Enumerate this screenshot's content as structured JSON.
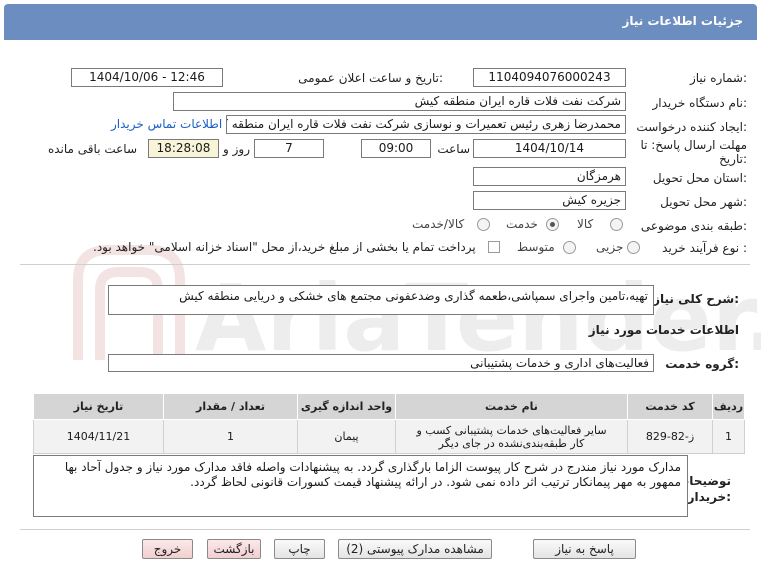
{
  "header": {
    "title": "جزئیات اطلاعات نیاز"
  },
  "fields": {
    "need_number_label": "شماره نیاز:",
    "need_number": "1104094076000243",
    "announce_label": "تاریخ و ساعت اعلان عمومی:",
    "announce_value": "1404/10/06 - 12:46",
    "buyer_org_label": "نام دستگاه خریدار:",
    "buyer_org": "شرکت نفت فلات قاره ایران منطقه کیش",
    "creator_label": "ایجاد کننده درخواست:",
    "creator": "محمدرضا  زهری رئیس تعمیرات و نوسازی  شرکت نفت فلات قاره ایران منطقه کیش",
    "contact_link": "اطلاعات تماس خریدار",
    "deadline_label_1": "مهلت ارسال پاسخ: تا",
    "deadline_label_2": "تاریخ:",
    "deadline_date": "1404/10/14",
    "time_label": "ساعت",
    "deadline_time": "09:00",
    "days_value": "7",
    "days_label": "روز و",
    "remaining_time": "18:28:08",
    "remaining_label": "ساعت باقی مانده",
    "province_label": "استان محل تحویل:",
    "province": "هرمزگان",
    "city_label": "شهر محل تحویل:",
    "city": "جزیره کیش",
    "category_label": "طبقه بندی موضوعی:",
    "category_options": [
      "کالا",
      "خدمت",
      "کالا/خدمت"
    ],
    "category_selected": "خدمت",
    "process_label": "نوع فرآیند خرید :",
    "process_options": [
      "جزیی",
      "متوسط"
    ],
    "process_note": "پرداخت تمام یا بخشی از مبلغ خرید،از محل \"اسناد خزانه اسلامی\" خواهد بود."
  },
  "description": {
    "label": "شرح کلی نیاز:",
    "text": "تهیه،تامین واجرای سمپاشی،طعمه گذاری وضدعفونی مجتمع های خشکی و دریایی منطقه کیش"
  },
  "services_section": {
    "title": "اطلاعات خدمات مورد نیاز",
    "group_label": "گروه خدمت:",
    "group_value": "فعالیت‌های اداری و خدمات پشتیبانی"
  },
  "table": {
    "headers": [
      "ردیف",
      "کد خدمت",
      "نام خدمت",
      "واحد اندازه گیری",
      "تعداد / مقدار",
      "تاریخ نیاز"
    ],
    "rows": [
      [
        "1",
        "ز-82-829",
        "سایر فعالیت‌های خدمات پشتیبانی کسب و کار طبقه‌بندی‌نشده در جای دیگر",
        "پیمان",
        "1",
        "1404/11/21"
      ]
    ]
  },
  "buyer_notes": {
    "label_1": "توضیحات",
    "label_2": "خریدار:",
    "text": "مدارک مورد نیاز مندرج در شرح کار پیوست الزاما بارگذاری گردد. به پیشنهادات واصله فاقد مدارک مورد نیاز و جدول آحاد بها ممهور به مهر پیمانکار ترتیب اثر داده نمی شود. در ارائه پیشنهاد قیمت کسورات قانونی لحاظ گردد."
  },
  "buttons": {
    "reply": "پاسخ به نیاز",
    "view_docs": "مشاهده مدارک پیوستی (2)",
    "print": "چاپ",
    "back": "بازگشت",
    "exit": "خروج"
  },
  "watermark_text": "AriaTender.neT"
}
